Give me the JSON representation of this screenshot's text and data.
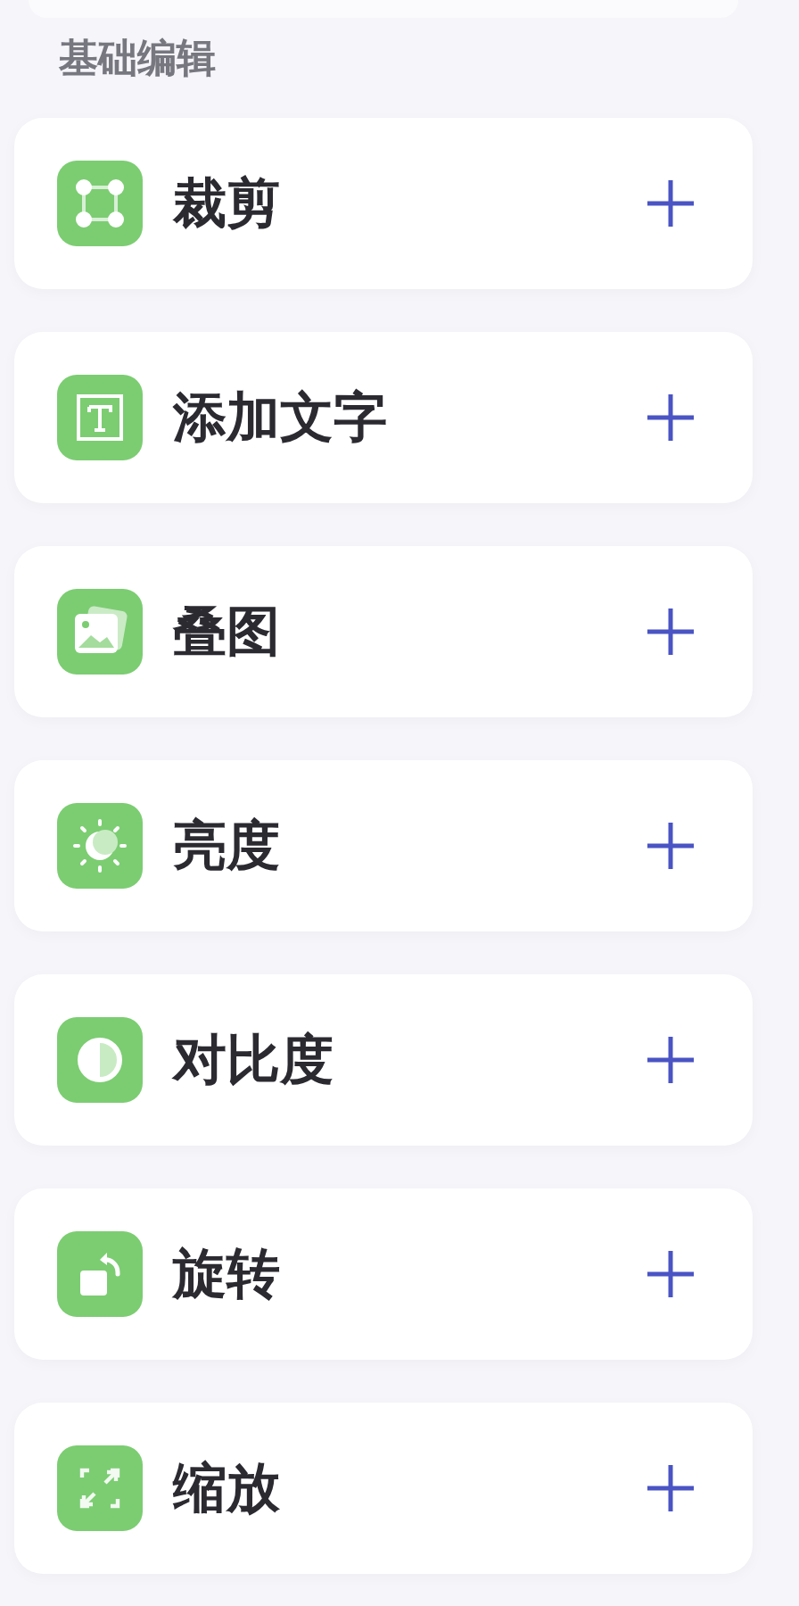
{
  "section_title": "基础编辑",
  "tools": [
    {
      "kind": "crop",
      "label": "裁剪"
    },
    {
      "kind": "text",
      "label": "添加文字"
    },
    {
      "kind": "image",
      "label": "叠图"
    },
    {
      "kind": "brightness",
      "label": "亮度"
    },
    {
      "kind": "contrast",
      "label": "对比度"
    },
    {
      "kind": "rotate",
      "label": "旋转"
    },
    {
      "kind": "scale",
      "label": "缩放"
    }
  ]
}
